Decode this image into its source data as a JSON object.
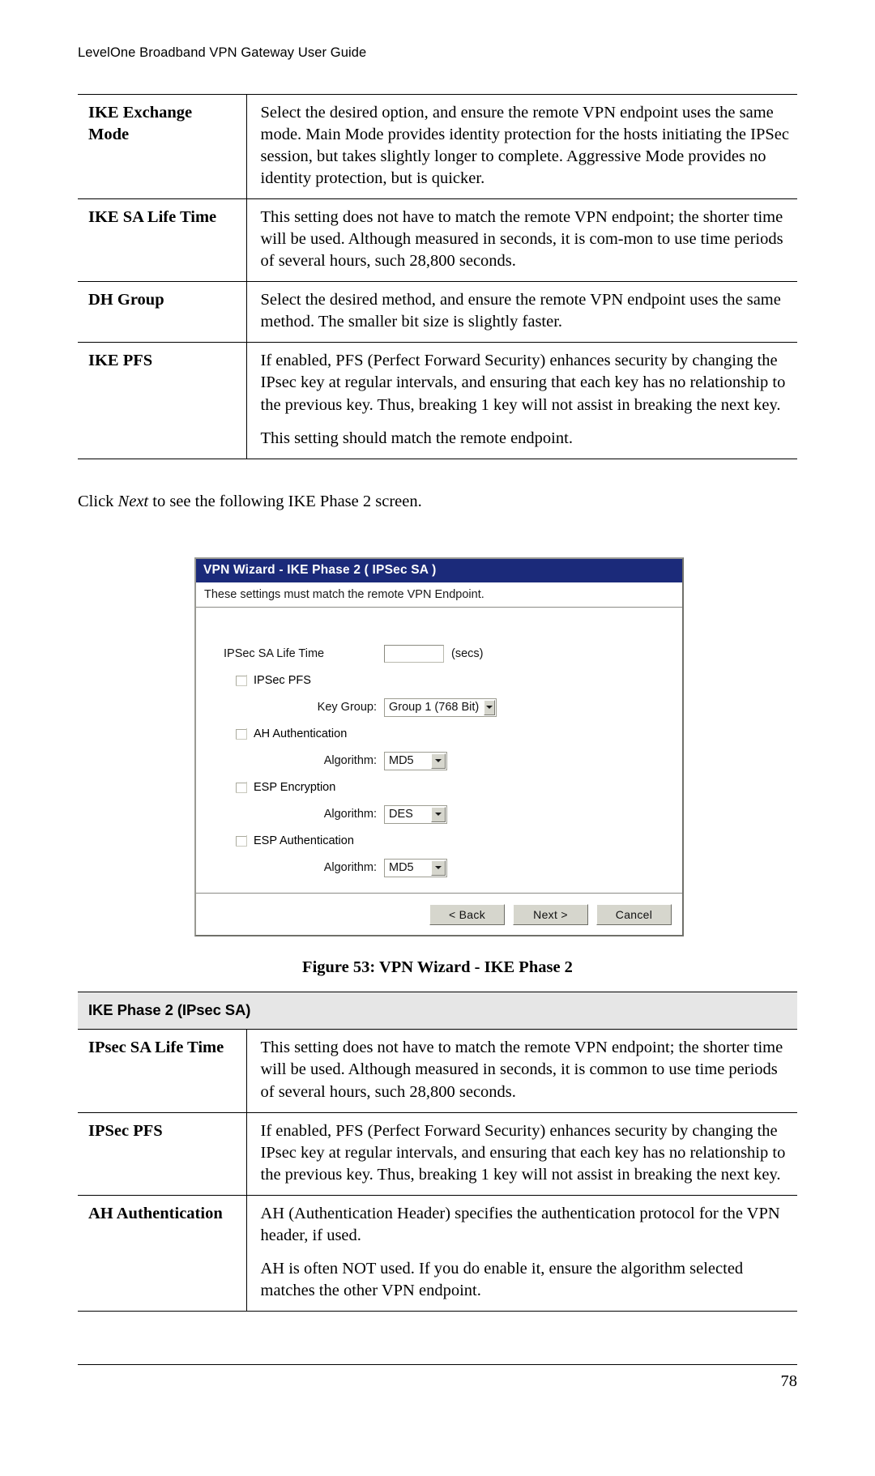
{
  "header": {
    "running_title": "LevelOne Broadband VPN Gateway User Guide"
  },
  "table_ike_phase1": {
    "rows": [
      {
        "label": "IKE Exchange Mode",
        "paragraphs": [
          "Select the desired option, and ensure the remote VPN endpoint uses the same mode. Main Mode provides identity protection for the hosts initiating the IPSec session, but takes slightly longer to complete. Aggressive Mode provides no identity protection, but is quicker."
        ]
      },
      {
        "label": "IKE SA Life Time",
        "paragraphs": [
          "This setting does not have to match the remote VPN endpoint; the shorter time will be used. Although measured in seconds, it is com-mon to use time periods of several hours, such 28,800 seconds."
        ]
      },
      {
        "label": "DH Group",
        "paragraphs": [
          "Select the desired method, and ensure the remote VPN endpoint uses the same method. The smaller bit size is slightly faster."
        ]
      },
      {
        "label": "IKE PFS",
        "paragraphs": [
          "If enabled, PFS (Perfect Forward Security) enhances security by changing the IPsec key at regular intervals, and ensuring that each key has no relationship to the previous key. Thus, breaking 1 key will not assist in breaking the next key.",
          "This setting should match the remote endpoint."
        ]
      }
    ]
  },
  "paragraph_click_next": {
    "before": "Click ",
    "italic": "Next",
    "after": " to see the following IKE Phase 2 screen."
  },
  "dialog": {
    "title": "VPN Wizard - IKE Phase 2 ( IPSec SA )",
    "subtitle": "These settings must match the remote VPN Endpoint.",
    "sa_life_time": {
      "label": "IPSec SA Life Time",
      "value": "",
      "unit": "(secs)"
    },
    "ipsec_pfs": {
      "label": "IPSec PFS",
      "checked": false
    },
    "key_group": {
      "label": "Key Group:",
      "value": "Group 1 (768 Bit)"
    },
    "ah_authentication": {
      "label": "AH Authentication",
      "checked": false
    },
    "ah_algorithm": {
      "label": "Algorithm:",
      "value": "MD5"
    },
    "esp_encryption": {
      "label": "ESP Encryption",
      "checked": false
    },
    "esp_encryption_algorithm": {
      "label": "Algorithm:",
      "value": "DES"
    },
    "esp_authentication": {
      "label": "ESP Authentication",
      "checked": false
    },
    "esp_authentication_algorithm": {
      "label": "Algorithm:",
      "value": "MD5"
    },
    "buttons": {
      "back": "< Back",
      "next": "Next >",
      "cancel": "Cancel"
    },
    "colors": {
      "titlebar": "#1b2a7a",
      "button_face": "#d6d6cd",
      "section_header": "#e6e6e6"
    }
  },
  "figure_caption": "Figure 53: VPN Wizard - IKE Phase 2",
  "table_ike_phase2": {
    "section_title": "IKE Phase 2 (IPsec SA)",
    "rows": [
      {
        "label": "IPsec SA Life Time",
        "paragraphs": [
          "This setting does not have to match the remote VPN endpoint; the shorter time will be used. Although measured in seconds, it is common to use time periods of several hours, such 28,800 seconds."
        ]
      },
      {
        "label": "IPSec PFS",
        "paragraphs": [
          "If enabled, PFS (Perfect Forward Security) enhances security by changing the IPsec key at regular intervals, and ensuring that each key has no relationship to the previous key. Thus, breaking 1 key will not assist in breaking the next key."
        ]
      },
      {
        "label": "AH Authentication",
        "paragraphs": [
          "AH (Authentication Header) specifies the authentication protocol for the VPN header, if used.",
          "AH is often NOT used. If you do enable it, ensure the algorithm selected matches the other VPN endpoint."
        ]
      }
    ]
  },
  "footer": {
    "page_number": "78"
  }
}
